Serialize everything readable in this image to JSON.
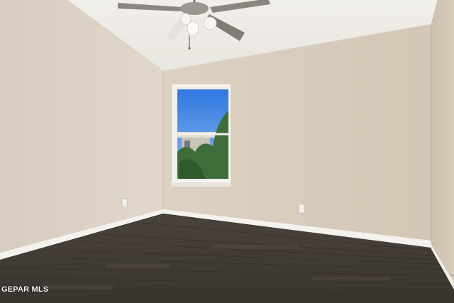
{
  "watermark": {
    "text": "GEPAR MLS"
  },
  "colors": {
    "ceiling": "#efede8",
    "left_wall": "#ddd3c7",
    "back_wall": "#d8cbbb",
    "right_wall": "#d6cab9",
    "floor": "#46403a",
    "baseboard": "#f4f2ee",
    "sky": "#3f86e6",
    "trees": "#3e6d3a"
  },
  "icons": {
    "fan": "ceiling-fan-icon",
    "outlet": "outlet-icon"
  }
}
